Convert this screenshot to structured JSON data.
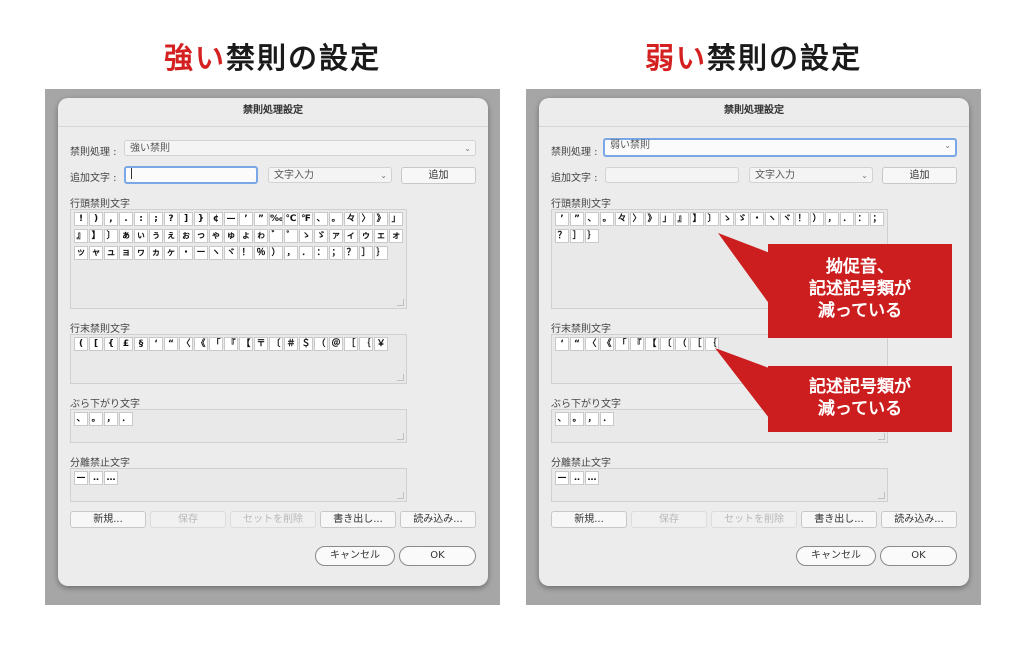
{
  "left_heading": {
    "accent": "強い",
    "rest": "禁則の設定"
  },
  "right_heading": {
    "accent": "弱い",
    "rest": "禁則の設定"
  },
  "dialog": {
    "title": "禁則処理設定",
    "kinsoku_label": "禁則処理 :",
    "add_char_label": "追加文字 :",
    "input_mode": "文字入力",
    "add_button": "追加",
    "section_start": "行頭禁則文字",
    "section_end": "行末禁則文字",
    "section_hang": "ぶら下がり文字",
    "section_nosep": "分離禁止文字",
    "btn_new": "新規...",
    "btn_save": "保存",
    "btn_delete": "セットを削除",
    "btn_export": "書き出し...",
    "btn_import": "読み込み...",
    "btn_cancel": "キャンセル",
    "btn_ok": "OK"
  },
  "strong": {
    "setting": "強い禁則",
    "start_chars": [
      "!",
      ")",
      ",",
      ".",
      ":",
      ";",
      "?",
      "]",
      "}",
      "¢",
      "—",
      "’",
      "”",
      "‰",
      "℃",
      "℉",
      "、",
      "。",
      "々",
      "〉",
      "》",
      "」",
      "』",
      "】",
      "〕",
      "ぁ",
      "ぃ",
      "ぅ",
      "ぇ",
      "ぉ",
      "っ",
      "ゃ",
      "ゅ",
      "ょ",
      "ゎ",
      "゛",
      "゜",
      "ゝ",
      "ゞ",
      "ァ",
      "ィ",
      "ゥ",
      "ェ",
      "ォ",
      "ッ",
      "ャ",
      "ュ",
      "ョ",
      "ヮ",
      "ヵ",
      "ヶ",
      "・",
      "ー",
      "ヽ",
      "ヾ",
      "！",
      "％",
      "）",
      "，",
      "．",
      "：",
      "；",
      "？",
      "］",
      "｝"
    ],
    "end_chars": [
      "(",
      "[",
      "{",
      "£",
      "§",
      "‘",
      "“",
      "〈",
      "《",
      "「",
      "『",
      "【",
      "〒",
      "〔",
      "＃",
      "＄",
      "（",
      "＠",
      "［",
      "｛",
      "￥"
    ],
    "hang_chars": [
      "、",
      "。",
      "，",
      "．"
    ],
    "nosep_chars": [
      "—",
      "‥",
      "…"
    ]
  },
  "weak": {
    "setting": "弱い禁則",
    "start_chars": [
      "’",
      "”",
      "、",
      "。",
      "々",
      "〉",
      "》",
      "」",
      "』",
      "】",
      "〕",
      "ゝ",
      "ゞ",
      "・",
      "ヽ",
      "ヾ",
      "！",
      "）",
      "，",
      "．",
      "：",
      "；",
      "？",
      "］",
      "｝"
    ],
    "end_chars": [
      "‘",
      "“",
      "〈",
      "《",
      "「",
      "『",
      "【",
      "〔",
      "（",
      "［",
      "｛"
    ],
    "hang_chars": [
      "、",
      "。",
      "，",
      "．"
    ],
    "nosep_chars": [
      "—",
      "‥",
      "…"
    ]
  },
  "callouts": {
    "first": [
      "拗促音、",
      "記述記号類が",
      "減っている"
    ],
    "second": [
      "記述記号類が",
      "減っている"
    ]
  },
  "colors": {
    "accent": "#d42020",
    "callout": "#cc1e1e",
    "focus": "#7aa8e6"
  }
}
